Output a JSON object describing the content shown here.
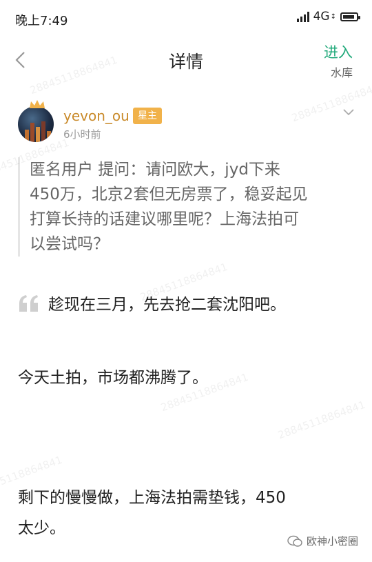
{
  "status_bar": {
    "time": "晚上7:49",
    "network": "4G",
    "network_sub": "↕",
    "battery_level": 0.9
  },
  "nav": {
    "back_icon": "chevron-left-icon",
    "title": "详情",
    "enter_label": "进入",
    "enter_sub": "水库",
    "enter_color": "#20a97a"
  },
  "post": {
    "username": "yevon_ou",
    "badge": "星主",
    "time": "6小时前",
    "username_color": "#c98a2a",
    "badge_color": "#f1b24a"
  },
  "question": {
    "lines": [
      "匿名用户  提问：请问欧大，jyd下来",
      "450万，北京2套但无房票了，稳妥起见",
      "打算长持的话建议哪里呢？上海法拍可",
      "以尝试吗？"
    ]
  },
  "answer": {
    "first_line": "趁现在三月，先去抢二套沈阳吧。",
    "paragraph_2": "今天土拍，市场都沸腾了。",
    "paragraph_3_line1": "剩下的慢慢做，上海法拍需垫钱，450",
    "paragraph_3_line2": "太少。"
  },
  "watermark_text": "2884511886​4841",
  "footer": {
    "brand": "欧神小密圈"
  }
}
